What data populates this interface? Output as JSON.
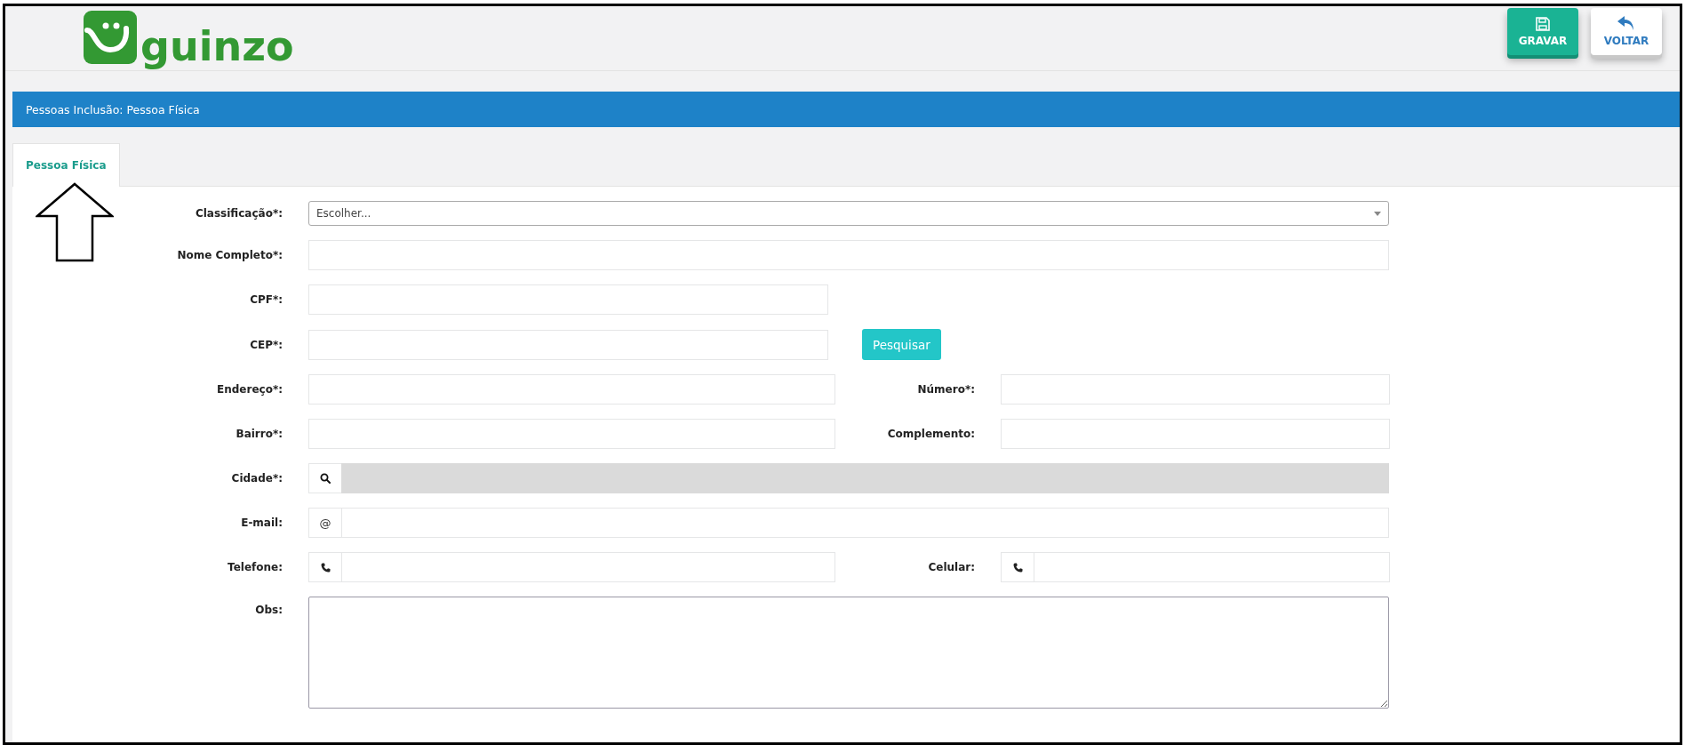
{
  "header": {
    "logo_text": "guinzo",
    "buttons": [
      {
        "label": "GRAVAR",
        "kind": "save"
      },
      {
        "label": "VOLTAR",
        "kind": "back"
      }
    ]
  },
  "title_bar": {
    "title": "Pessoas Inclusão: Pessoa Física"
  },
  "tabs": [
    {
      "label": "Pessoa Física",
      "selected": true
    }
  ],
  "form": {
    "rows": [
      {
        "fields": [
          {
            "label": "Classificação*:",
            "kind": "select",
            "placeholder": "Escolher..."
          }
        ]
      },
      {
        "fields": [
          {
            "label": "Nome Completo*:",
            "kind": "text"
          }
        ]
      },
      {
        "fields": [
          {
            "label": "CPF*:",
            "kind": "short_text"
          }
        ]
      },
      {
        "fields": [
          {
            "label": "CEP*:",
            "kind": "short_text",
            "button": "Pesquisar"
          }
        ]
      },
      {
        "fields": [
          {
            "label": "Endereço*:",
            "kind": "text"
          },
          {
            "label": "Número*:",
            "kind": "text"
          }
        ]
      },
      {
        "fields": [
          {
            "label": "Bairro*:",
            "kind": "text"
          },
          {
            "label": "Complemento:",
            "kind": "text"
          }
        ]
      },
      {
        "fields": [
          {
            "label": "Cidade*:",
            "kind": "search",
            "disabled": true
          }
        ]
      },
      {
        "fields": [
          {
            "label": "E-mail:",
            "kind": "addon_text",
            "addon": "@"
          }
        ]
      },
      {
        "fields": [
          {
            "label": "Telefone:",
            "kind": "phone"
          },
          {
            "label": "Celular:",
            "kind": "phone"
          }
        ]
      },
      {
        "fields": [
          {
            "label": "Obs:",
            "kind": "textarea"
          }
        ]
      }
    ]
  }
}
